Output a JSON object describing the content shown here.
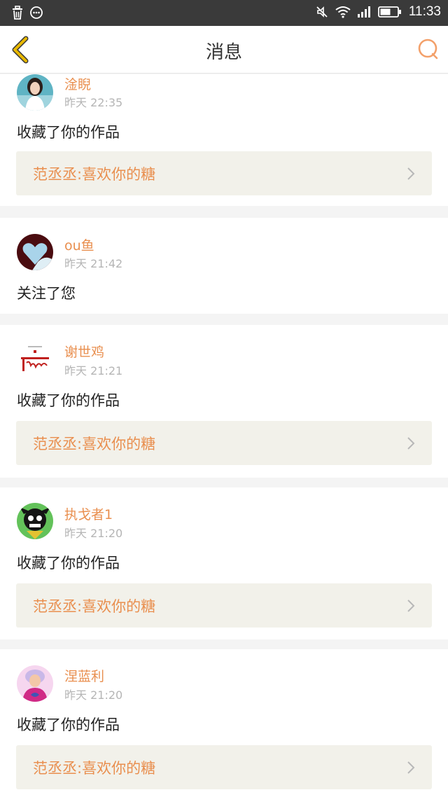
{
  "status_bar": {
    "time": "11:33",
    "left_icons": [
      "trash-icon",
      "message-bubble-icon"
    ],
    "right_icons": [
      "mute-icon",
      "wifi-icon",
      "signal-icon",
      "battery-icon"
    ]
  },
  "header": {
    "title": "消息",
    "accent_color": "#e8b800",
    "chat_icon_color": "#f3a06a"
  },
  "notifications": [
    {
      "user": "淦睨",
      "time": "昨天 22:35",
      "action": "收藏了你的作品",
      "work": "范丞丞:喜欢你的糖"
    },
    {
      "user": "ou鱼",
      "time": "昨天 21:42",
      "action": "关注了您",
      "work": null
    },
    {
      "user": "谢世鸡",
      "time": "昨天 21:21",
      "action": "收藏了你的作品",
      "work": "范丞丞:喜欢你的糖"
    },
    {
      "user": "执戈者1",
      "time": "昨天 21:20",
      "action": "收藏了你的作品",
      "work": "范丞丞:喜欢你的糖"
    },
    {
      "user": "涅蓝利",
      "time": "昨天 21:20",
      "action": "收藏了你的作品",
      "work": "范丞丞:喜欢你的糖"
    }
  ],
  "colors": {
    "username": "#e98f4f",
    "link_bg": "#f2f1ea",
    "timestamp": "#b5b5b5"
  }
}
